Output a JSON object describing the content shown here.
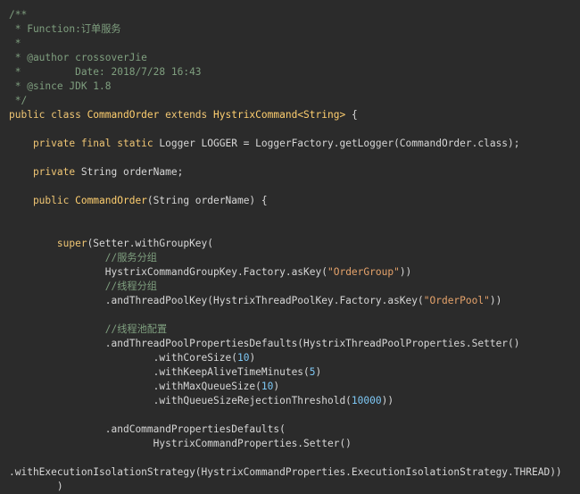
{
  "editor": {
    "background": "#2b2b2b",
    "lines": [
      [
        {
          "t": "/**",
          "c": "comment"
        }
      ],
      [
        {
          "t": " * Function:订单服务",
          "c": "comment"
        }
      ],
      [
        {
          "t": " *",
          "c": "comment"
        }
      ],
      [
        {
          "t": " * @author crossoverJie",
          "c": "comment"
        }
      ],
      [
        {
          "t": " *         Date: 2018/7/28 16:43",
          "c": "comment"
        }
      ],
      [
        {
          "t": " * @since JDK 1.8",
          "c": "comment"
        }
      ],
      [
        {
          "t": " */",
          "c": "comment"
        }
      ],
      [
        {
          "t": "public class ",
          "c": "keyword"
        },
        {
          "t": "CommandOrder",
          "c": "type"
        },
        {
          "t": " extends ",
          "c": "keyword"
        },
        {
          "t": "HystrixCommand",
          "c": "type"
        },
        {
          "t": "<String>",
          "c": "type"
        },
        {
          "t": " {",
          "c": "punct"
        }
      ],
      [],
      [
        {
          "t": "    private final static ",
          "c": "keyword"
        },
        {
          "t": "Logger LOGGER = LoggerFactory.getLogger(CommandOrder.class);",
          "c": "plain"
        }
      ],
      [],
      [
        {
          "t": "    private ",
          "c": "keyword"
        },
        {
          "t": "String orderName;",
          "c": "plain"
        }
      ],
      [],
      [
        {
          "t": "    public ",
          "c": "keyword"
        },
        {
          "t": "CommandOrder",
          "c": "type"
        },
        {
          "t": "(String orderName) {",
          "c": "plain"
        }
      ],
      [],
      [],
      [
        {
          "t": "        super",
          "c": "keyword"
        },
        {
          "t": "(Setter.withGroupKey(",
          "c": "plain"
        }
      ],
      [
        {
          "t": "                //服务分组",
          "c": "comment"
        }
      ],
      [
        {
          "t": "                HystrixCommandGroupKey.Factory.asKey(",
          "c": "plain"
        },
        {
          "t": "\"OrderGroup\"",
          "c": "string"
        },
        {
          "t": "))",
          "c": "plain"
        }
      ],
      [
        {
          "t": "                //线程分组",
          "c": "comment"
        }
      ],
      [
        {
          "t": "                .andThreadPoolKey(HystrixThreadPoolKey.Factory.asKey(",
          "c": "plain"
        },
        {
          "t": "\"OrderPool\"",
          "c": "string"
        },
        {
          "t": "))",
          "c": "plain"
        }
      ],
      [],
      [
        {
          "t": "                //线程池配置",
          "c": "comment"
        }
      ],
      [
        {
          "t": "                .andThreadPoolPropertiesDefaults(HystrixThreadPoolProperties.Setter()",
          "c": "plain"
        }
      ],
      [
        {
          "t": "                        .withCoreSize(",
          "c": "plain"
        },
        {
          "t": "10",
          "c": "number"
        },
        {
          "t": ")",
          "c": "plain"
        }
      ],
      [
        {
          "t": "                        .withKeepAliveTimeMinutes(",
          "c": "plain"
        },
        {
          "t": "5",
          "c": "number"
        },
        {
          "t": ")",
          "c": "plain"
        }
      ],
      [
        {
          "t": "                        .withMaxQueueSize(",
          "c": "plain"
        },
        {
          "t": "10",
          "c": "number"
        },
        {
          "t": ")",
          "c": "plain"
        }
      ],
      [
        {
          "t": "                        .withQueueSizeRejectionThreshold(",
          "c": "plain"
        },
        {
          "t": "10000",
          "c": "number"
        },
        {
          "t": "))",
          "c": "plain"
        }
      ],
      [],
      [
        {
          "t": "                .andCommandPropertiesDefaults(",
          "c": "plain"
        }
      ],
      [
        {
          "t": "                        HystrixCommandProperties.Setter()",
          "c": "plain"
        }
      ],
      [],
      [
        {
          "t": ".withExecutionIsolationStrategy(HystrixCommandProperties.ExecutionIsolationStrategy.THREAD))",
          "c": "plain"
        }
      ],
      [
        {
          "t": "        )",
          "c": "plain"
        }
      ]
    ]
  }
}
